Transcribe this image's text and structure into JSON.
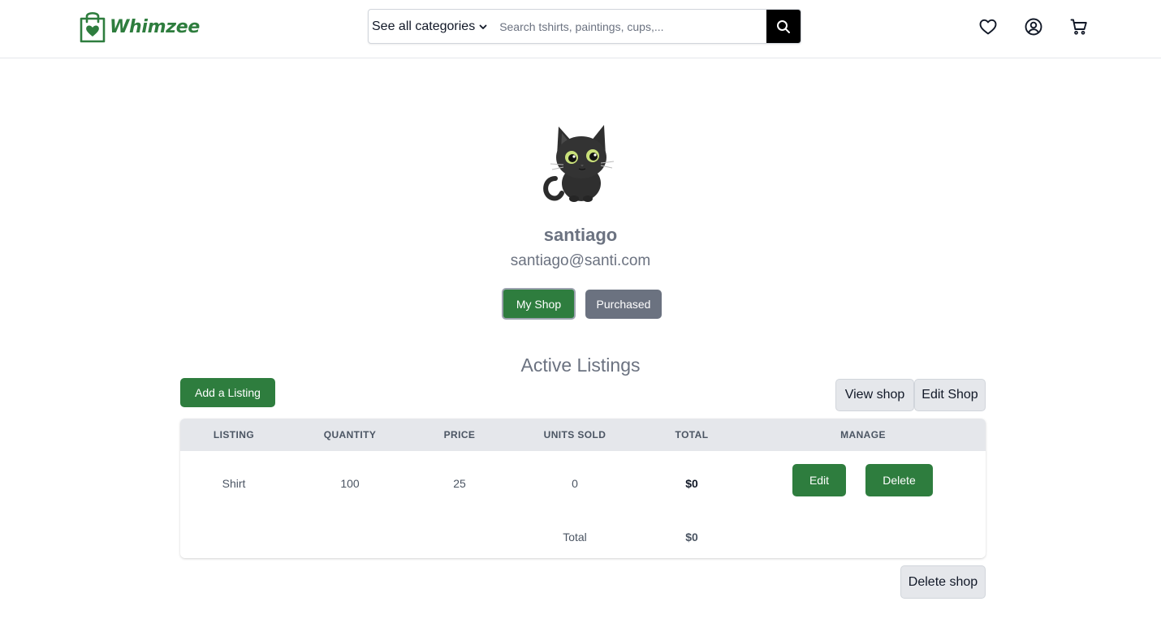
{
  "brand": {
    "name": "Whimzee",
    "color": "#2e7d3e",
    "icon": "shopping-bag-heart-icon"
  },
  "search": {
    "category_label": "See all categories",
    "placeholder": "Search tshirts, paintings, cups,...",
    "value": ""
  },
  "header_icons": [
    "heart-icon",
    "user-circle-icon",
    "cart-icon"
  ],
  "profile": {
    "avatar": "black-cat-avatar",
    "username": "santiago",
    "email": "santiago@santi.com",
    "tabs": {
      "my_shop": "My Shop",
      "purchased": "Purchased"
    }
  },
  "listings": {
    "title": "Active Listings",
    "add_label": "Add a Listing",
    "view_shop_label": "View shop",
    "edit_shop_label": "Edit Shop",
    "delete_shop_label": "Delete shop",
    "columns": [
      "LISTING",
      "QUANTITY",
      "PRICE",
      "UNITS SOLD",
      "TOTAL",
      "MANAGE"
    ],
    "rows": [
      {
        "listing": "Shirt",
        "quantity": "100",
        "price": "25",
        "units_sold": "0",
        "total": "$0",
        "edit_label": "Edit",
        "delete_label": "Delete"
      }
    ],
    "footer": {
      "label": "Total",
      "value": "$0"
    }
  },
  "colors": {
    "accent": "#2e7d3e",
    "secondary": "#6b7280",
    "table_header": "#e5e7eb"
  }
}
